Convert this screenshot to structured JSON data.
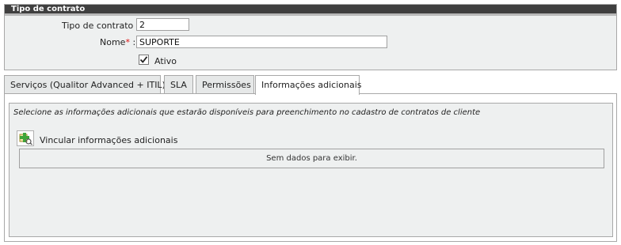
{
  "panel": {
    "title": "Tipo de contrato"
  },
  "form": {
    "tipo_label": "Tipo de contrato :",
    "tipo_value": "2",
    "nome_label": "Nome",
    "required_mark": "*",
    "colon": " :",
    "nome_value": "SUPORTE",
    "ativo_label": "Ativo",
    "ativo_checked": true
  },
  "tabs": [
    {
      "label": "Serviços (Qualitor Advanced + ITIL)",
      "active": false
    },
    {
      "label": "SLA",
      "active": false
    },
    {
      "label": "Permissões",
      "active": false
    },
    {
      "label": "Informações adicionais",
      "active": true
    }
  ],
  "content": {
    "hint": "Selecione as informações adicionais que estarão disponíveis para preenchimento no cadastro de contratos de cliente",
    "link_label": "Vincular informações adicionais",
    "link_icon": "add-link-icon",
    "empty_text": "Sem dados para exibir."
  }
}
